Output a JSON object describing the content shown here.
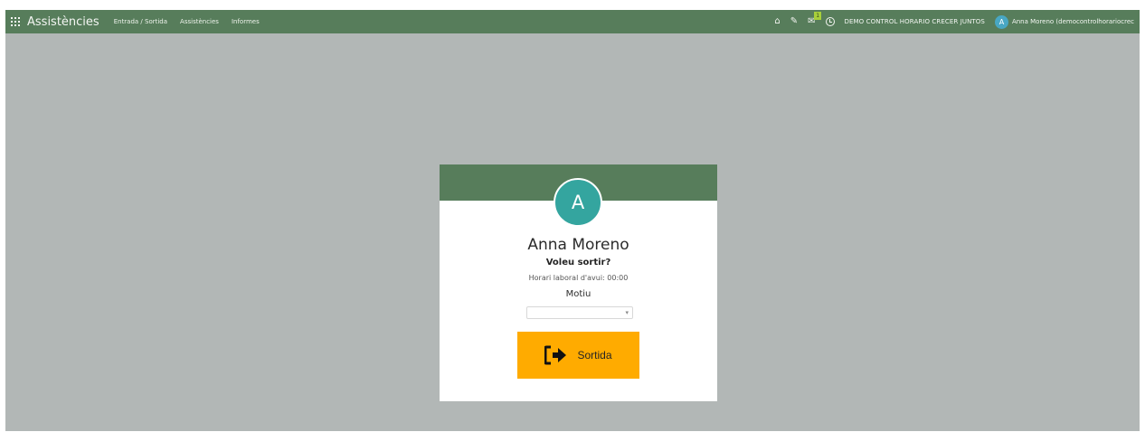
{
  "navbar": {
    "app_title": "Assistències",
    "menu": [
      "Entrada / Sortida",
      "Assistències",
      "Informes"
    ],
    "company": "DEMO CONTROL HORARIO CRECER JUNTOS",
    "user_initial": "A",
    "user_name": "Anna Moreno (democontrolhorariocrec",
    "chat_badge": "1"
  },
  "card": {
    "avatar_initial": "A",
    "employee_name": "Anna Moreno",
    "question": "Voleu sortir?",
    "schedule": "Horari laboral d'avui: 00:00",
    "reason_label": "Motiu",
    "reason_value": "",
    "button_label": "Sortida"
  },
  "colors": {
    "navbar": "#577d5b",
    "background": "#b2b7b6",
    "avatar": "#34a59f",
    "button": "#ffab00"
  },
  "icons": {
    "apps": "grid-icon",
    "home": "home-icon",
    "edit": "pencil-icon",
    "chat": "chat-icon",
    "clock": "clock-icon",
    "logout": "logout-arrow-icon"
  }
}
